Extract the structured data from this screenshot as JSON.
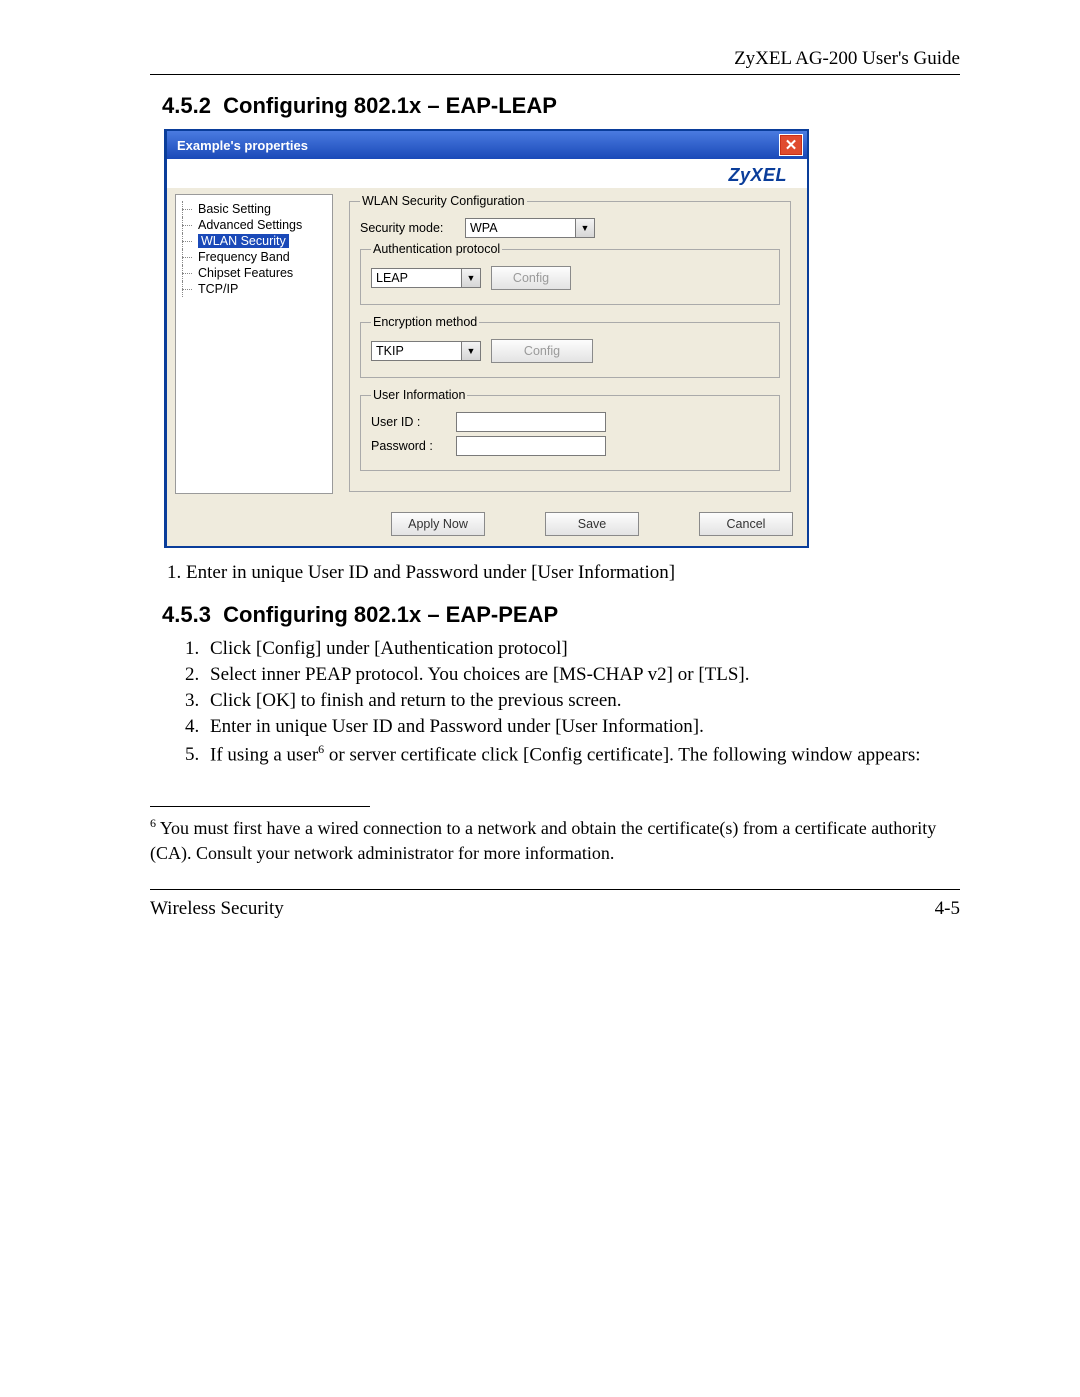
{
  "header": {
    "doc_title": "ZyXEL AG-200 User's Guide"
  },
  "section_452": {
    "number": "4.5.2",
    "title": "Configuring 802.1x – EAP-LEAP"
  },
  "dialog": {
    "title": "Example's properties",
    "brand": "ZyXEL",
    "tree": [
      {
        "label": "Basic Setting",
        "selected": false
      },
      {
        "label": "Advanced Settings",
        "selected": false
      },
      {
        "label": "WLAN Security",
        "selected": true
      },
      {
        "label": "Frequency Band",
        "selected": false
      },
      {
        "label": "Chipset Features",
        "selected": false
      },
      {
        "label": "TCP/IP",
        "selected": false
      }
    ],
    "wlan_group_label": "WLAN Security Configuration",
    "security_mode_label": "Security mode:",
    "security_mode_value": "WPA",
    "auth_group_label": "Authentication protocol",
    "auth_value": "LEAP",
    "auth_config_btn": "Config",
    "enc_group_label": "Encryption method",
    "enc_value": "TKIP",
    "enc_config_btn": "Config",
    "user_group_label": "User Information",
    "user_id_label": "User ID :",
    "password_label": "Password :",
    "buttons": {
      "apply": "Apply Now",
      "save": "Save",
      "cancel": "Cancel"
    }
  },
  "list_452": [
    "Enter in unique User ID and Password under [User Information]"
  ],
  "section_453": {
    "number": "4.5.3",
    "title": "Configuring 802.1x – EAP-PEAP"
  },
  "list_453": {
    "i1": "Click [Config] under [Authentication protocol]",
    "i2": "Select inner PEAP protocol.  You choices are [MS-CHAP v2] or [TLS].",
    "i3": "Click [OK] to finish and return to the previous screen.",
    "i4": "Enter in unique User ID and Password under [User Information].",
    "i5a": "If using a user",
    "i5_sup": "6",
    "i5b": " or server certificate click [Config certificate].  The following window appears:"
  },
  "footnote": {
    "num": "6",
    "text": " You must first have a wired connection to a network and obtain the certificate(s) from a certificate authority (CA). Consult your network administrator for more information."
  },
  "footer": {
    "left": "Wireless Security",
    "right": "4-5"
  }
}
